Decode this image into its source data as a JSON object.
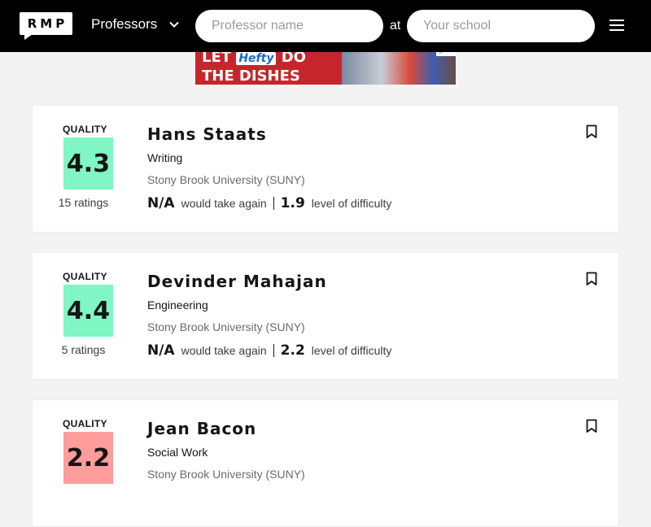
{
  "header": {
    "logo_text": "RMP",
    "search_type": "Professors",
    "professor_placeholder": "Professor name",
    "at_label": "at",
    "school_placeholder": "Your school"
  },
  "ad": {
    "line1": "LET",
    "brand": "Hefty",
    "line1b": "DO",
    "line2": "THE DISHES"
  },
  "colors": {
    "quality_high": "#7ff6c3",
    "quality_low": "#ff9c9c"
  },
  "professors": [
    {
      "quality_label": "QUALITY",
      "quality": "4.3",
      "quality_level": "high",
      "ratings": "15 ratings",
      "name": "Hans Staats",
      "department": "Writing",
      "school": "Stony Brook University (SUNY)",
      "take_again": "N/A",
      "take_again_label": "would take again",
      "difficulty": "1.9",
      "difficulty_label": "level of difficulty"
    },
    {
      "quality_label": "QUALITY",
      "quality": "4.4",
      "quality_level": "high",
      "ratings": "5 ratings",
      "name": "Devinder Mahajan",
      "department": "Engineering",
      "school": "Stony Brook University (SUNY)",
      "take_again": "N/A",
      "take_again_label": "would take again",
      "difficulty": "2.2",
      "difficulty_label": "level of difficulty"
    },
    {
      "quality_label": "QUALITY",
      "quality": "2.2",
      "quality_level": "low",
      "ratings": "",
      "name": "Jean Bacon",
      "department": "Social Work",
      "school": "Stony Brook University (SUNY)",
      "take_again": "",
      "take_again_label": "",
      "difficulty": "",
      "difficulty_label": ""
    }
  ]
}
